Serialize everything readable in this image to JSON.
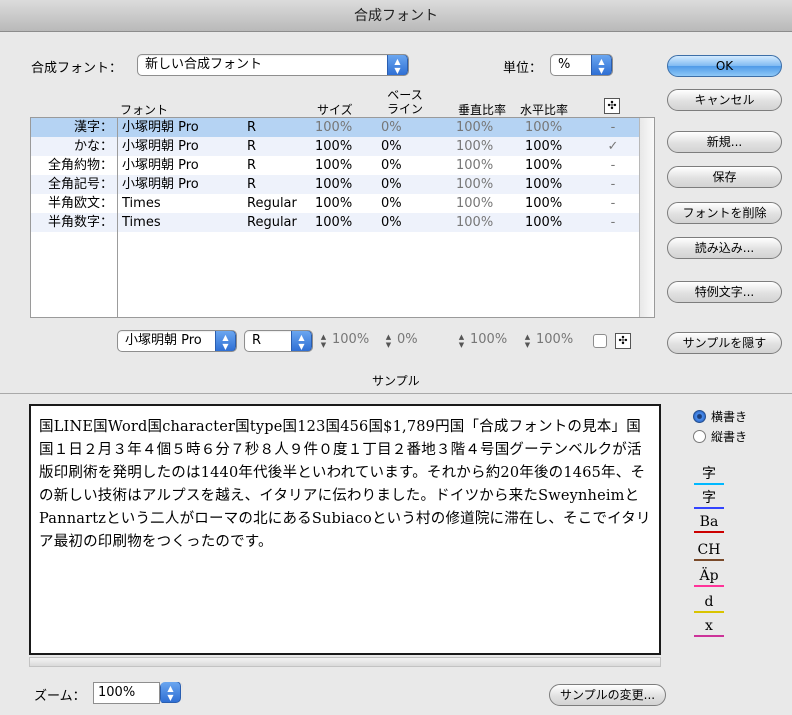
{
  "window": {
    "title": "合成フォント"
  },
  "composite_font": {
    "label": "合成フォント：",
    "value": "新しい合成フォント"
  },
  "unit": {
    "label": "単位：",
    "value": "%"
  },
  "buttons": {
    "ok": "OK",
    "cancel": "キャンセル",
    "new": "新規...",
    "save": "保存",
    "delete_font": "フォントを削除",
    "import": "読み込み...",
    "exception_chars": "特例文字...",
    "hide_sample": "サンプルを隠す",
    "change_sample": "サンプルの変更..."
  },
  "table": {
    "headers": {
      "font": "フォント",
      "size": "サイズ",
      "baseline_1": "ベース",
      "baseline_2": "ライン",
      "vscale": "垂直比率",
      "hscale": "水平比率",
      "center_icon": "cross-arrows-icon"
    },
    "rows": [
      {
        "label": "漢字：",
        "font": "小塚明朝 Pro",
        "style": "R",
        "size": "100%",
        "baseline": "0%",
        "vscale": "100%",
        "hscale": "100%",
        "center": "-"
      },
      {
        "label": "かな：",
        "font": "小塚明朝 Pro",
        "style": "R",
        "size": "100%",
        "baseline": "0%",
        "vscale": "100%",
        "hscale": "100%",
        "center": "✓"
      },
      {
        "label": "全角約物：",
        "font": "小塚明朝 Pro",
        "style": "R",
        "size": "100%",
        "baseline": "0%",
        "vscale": "100%",
        "hscale": "100%",
        "center": "-"
      },
      {
        "label": "全角記号：",
        "font": "小塚明朝 Pro",
        "style": "R",
        "size": "100%",
        "baseline": "0%",
        "vscale": "100%",
        "hscale": "100%",
        "center": "-"
      },
      {
        "label": "半角欧文：",
        "font": "Times",
        "style": "Regular",
        "size": "100%",
        "baseline": "0%",
        "vscale": "100%",
        "hscale": "100%",
        "center": "-"
      },
      {
        "label": "半角数字：",
        "font": "Times",
        "style": "Regular",
        "size": "100%",
        "baseline": "0%",
        "vscale": "100%",
        "hscale": "100%",
        "center": "-"
      }
    ]
  },
  "controls": {
    "font": "小塚明朝 Pro",
    "style": "R",
    "size": "100%",
    "baseline": "0%",
    "vscale": "100%",
    "hscale": "100%",
    "stepper_glyph": "▲▼"
  },
  "sample": {
    "heading": "サンプル",
    "text": "国LINE国Word国character国type国123国456国$1,789円国「合成フォントの見本」国国１日２月３年４個５時６分７秒８人９件０度１丁目２番地３階４号国グーテンベルクが活版印刷術を発明したのは1440年代後半といわれています。それから約20年後の1465年、その新しい技術はアルプスを越え、イタリアに伝わりました。ドイツから来たSweynheimとPannartzという二人がローマの北にあるSubiacoという村の修道院に滞在し、そこでイタリア最初の印刷物をつくったのです。"
  },
  "orientation": {
    "horizontal": "横書き",
    "vertical": "縦書き"
  },
  "guides": [
    "字",
    "字",
    "Ba",
    "CH",
    "Äp",
    "d",
    "x"
  ],
  "guide_colors": [
    "#00b8ff",
    "#3344ff",
    "#cc0000",
    "#7a4a2a",
    "#ff3399",
    "#d9c400",
    "#cc3399"
  ],
  "zoom": {
    "label": "ズーム：",
    "value": "100%"
  },
  "colors": {
    "selected_row": "#b5d3f3",
    "accent": "#3d7ee0"
  }
}
